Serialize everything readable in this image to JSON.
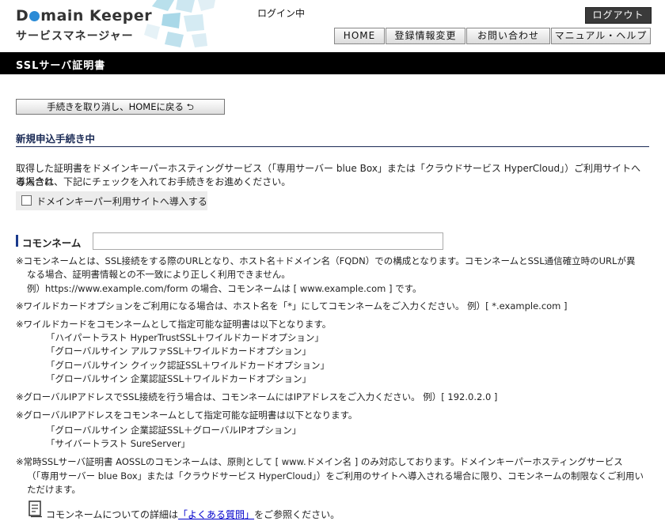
{
  "header": {
    "logo_before": "D",
    "logo_after": "main Keeper",
    "logo_sub": "サービスマネージャー",
    "login_status": "ログイン中",
    "logout": "ログアウト",
    "nav": [
      "HOME",
      "登録情報変更",
      "お問い合わせ",
      "マニュアル・ヘルプ"
    ]
  },
  "page_title": "SSLサーバ証明書",
  "cancel_button": "手続きを取り消し、HOMEに戻る ⮌",
  "section_title": "新規申込手続き中",
  "intro": [
    "取得した証明書をドメインキーパーホスティングサービス（「専用サーバー blue Box」または「クラウドサービス HyperCloud」）ご利用サイトへ導入され",
    "る場合は、下記にチェックを入れてお手続きをお進めください。"
  ],
  "checkbox_label": "ドメインキーパー利用サイトへ導入する",
  "common_name": {
    "label": "コモンネーム",
    "value": "",
    "placeholder": ""
  },
  "notes": [
    "※コモンネームとは、SSL接続をする際のURLとなり、ホスト名＋ドメイン名（FQDN）での構成となります。コモンネームとSSL通信確立時のURLが異",
    "なる場合、証明書情報との不一致により正しく利用できません。",
    "例）https://www.example.com/form の場合、コモンネームは [ www.example.com ] です。",
    "※ワイルドカードオプションをご利用になる場合は、ホスト名を「*」にしてコモンネームをご入力ください。 例）[ *.example.com ]",
    "※ワイルドカードをコモンネームとして指定可能な証明書は以下となります。",
    "「ハイパートラスト HyperTrustSSL＋ワイルドカードオプション」",
    "「グローバルサイン アルファSSL＋ワイルドカードオプション」",
    "「グローバルサイン クイック認証SSL＋ワイルドカードオプション」",
    "「グローバルサイン 企業認証SSL＋ワイルドカードオプション」",
    "※グローバルIPアドレスでSSL接続を行う場合は、コモンネームにはIPアドレスをご入力ください。 例）[ 192.0.2.0 ]",
    "※グローバルIPアドレスをコモンネームとして指定可能な証明書は以下となります。",
    "「グローバルサイン 企業認証SSL＋グローバルIPオプション」",
    "「サイバートラスト SureServer」",
    "※常時SSLサーバ証明書 AOSSLのコモンネームは、原則として [ www.ドメイン名 ] のみ対応しております。ドメインキーパーホスティングサービス",
    "（「専用サーバー blue Box」または「クラウドサービス HyperCloud」）をご利用のサイトへ導入される場合に限り、コモンネームの制限なくご利用い",
    "ただけます。"
  ],
  "faq": {
    "before": "コモンネームについての詳細は",
    "link": "「よくある質問」",
    "after": "をご参照ください。"
  },
  "colors": {
    "title_bar": "#000000",
    "section_title": "#1a2a55",
    "link": "#0000cc",
    "logo_dot": "#2b8bd6"
  }
}
